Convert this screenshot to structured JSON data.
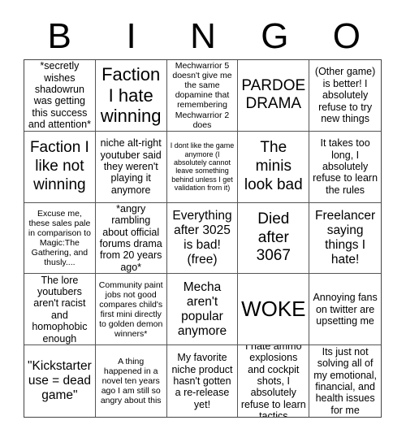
{
  "header": {
    "letters": [
      "B",
      "I",
      "N",
      "G",
      "O"
    ]
  },
  "cells": [
    "*secretly wishes shadowrun was getting this success and attention*",
    "Faction I hate winning",
    "Mechwarrior 5 doesn't give me the same dopamine that remembering Mechwarrior 2 does",
    "PARDOE DRAMA",
    "(Other game) is better! I absolutely refuse to try new things",
    "Faction I like not winning",
    "niche alt-right youtuber said they weren't playing it anymore",
    "I dont like the game anymore (I absolutely cannot leave something behind unless I get validation from it)",
    "The minis look bad",
    "It takes too long, I absolutely refuse to learn the rules",
    "Excuse me, these sales pale in comparison to Magic:The Gathering, and thusly....",
    "*angry rambling about official forums drama from 20 years ago*",
    "Everything after 3025 is bad! (free)",
    "Died after 3067",
    "Freelancer saying things I hate!",
    "The lore youtubers aren't racist and homophobic enough",
    "Community paint jobs not good compares child's first mini directly to golden demon winners*",
    "Mecha aren't popular anymore",
    "WOKE",
    "Annoying fans on twitter are upsetting me",
    "\"Kickstarter use = dead game\"",
    "A thing happened in a novel ten years ago I am still so angry about this",
    "My favorite niche product hasn't gotten a re-release yet!",
    "I hate ammo explosions and cockpit shots, I absolutely refuse to learn tactics",
    "Its just not solving all of my emotional, financial, and health issues for me"
  ]
}
